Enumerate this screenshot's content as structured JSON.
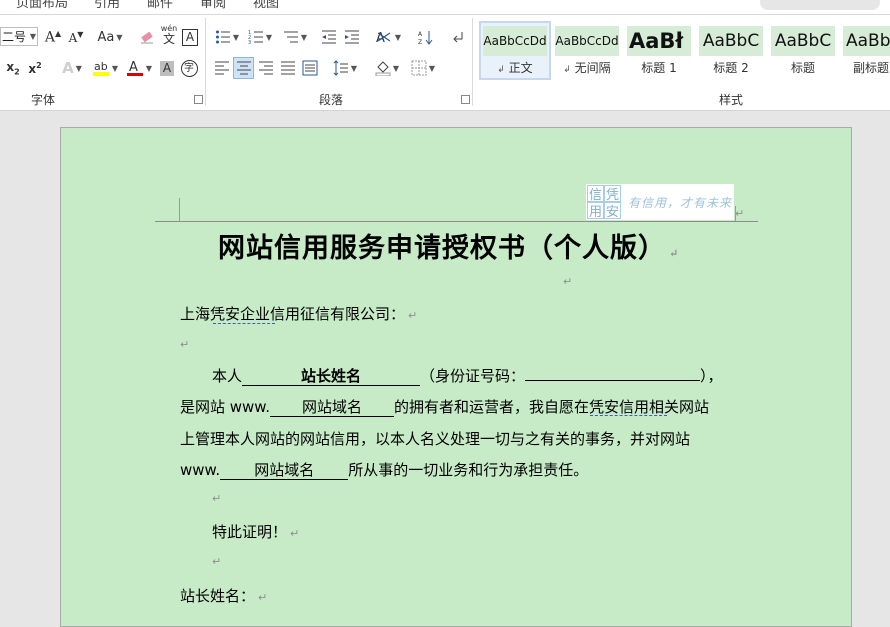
{
  "ribbon": {
    "tabs": [
      "页面布局",
      "引用",
      "邮件",
      "审阅",
      "视图"
    ],
    "font_group": {
      "label": "字体",
      "font_size": "二号",
      "case_label": "Aa",
      "phonetic_label": "wén",
      "phonetic_char": "文",
      "border_char": "A",
      "enclose_char": "字"
    },
    "paragraph_group": {
      "label": "段落"
    },
    "styles_group": {
      "label": "样式",
      "styles": [
        {
          "preview": "AaBbCcDd",
          "name": "正文",
          "marker": "↲",
          "selected": true
        },
        {
          "preview": "AaBbCcDd",
          "name": "无间隔",
          "marker": "↲",
          "selected": false
        },
        {
          "preview": "AaBł",
          "name": "标题 1",
          "marker": "",
          "selected": false
        },
        {
          "preview": "AaBbC",
          "name": "标题 2",
          "marker": "",
          "selected": false
        },
        {
          "preview": "AaBbC",
          "name": "标题",
          "marker": "",
          "selected": false
        },
        {
          "preview": "AaBb",
          "name": "副标题",
          "marker": "",
          "selected": false
        }
      ]
    },
    "colors": {
      "highlight": "#ffff00",
      "font_color": "#e00000",
      "style_preview_bg": "#d6ecd6"
    }
  },
  "document": {
    "page_bg": "#c7ebc7",
    "header_logo": {
      "seal_chars": [
        "信",
        "凭",
        "用",
        "安"
      ],
      "slogan": "有信用，才有未来"
    },
    "title": "网站信用服务申请授权书（个人版）",
    "addressee": "上海凭安企业信用征信有限公司：",
    "para1": {
      "prefix": "本人",
      "blank_name": "站长姓名",
      "id_label": "（身份证号码：",
      "id_blank": "",
      "id_close": "），"
    },
    "para2": {
      "prefix": "是网站 www.",
      "blank_domain": "网站域名",
      "text": "的拥有者和运营者，我自愿在凭安信用相关网站"
    },
    "para3": "上管理本人网站的网站信用，以本人名义处理一切与之有关的事务，并对网站",
    "para4": {
      "prefix": "www.",
      "blank_domain": "网站域名",
      "text": "所从事的一切业务和行为承担责任。"
    },
    "certify": "特此证明！",
    "signature_label": "站长姓名：",
    "paragraph_mark": "↵"
  }
}
